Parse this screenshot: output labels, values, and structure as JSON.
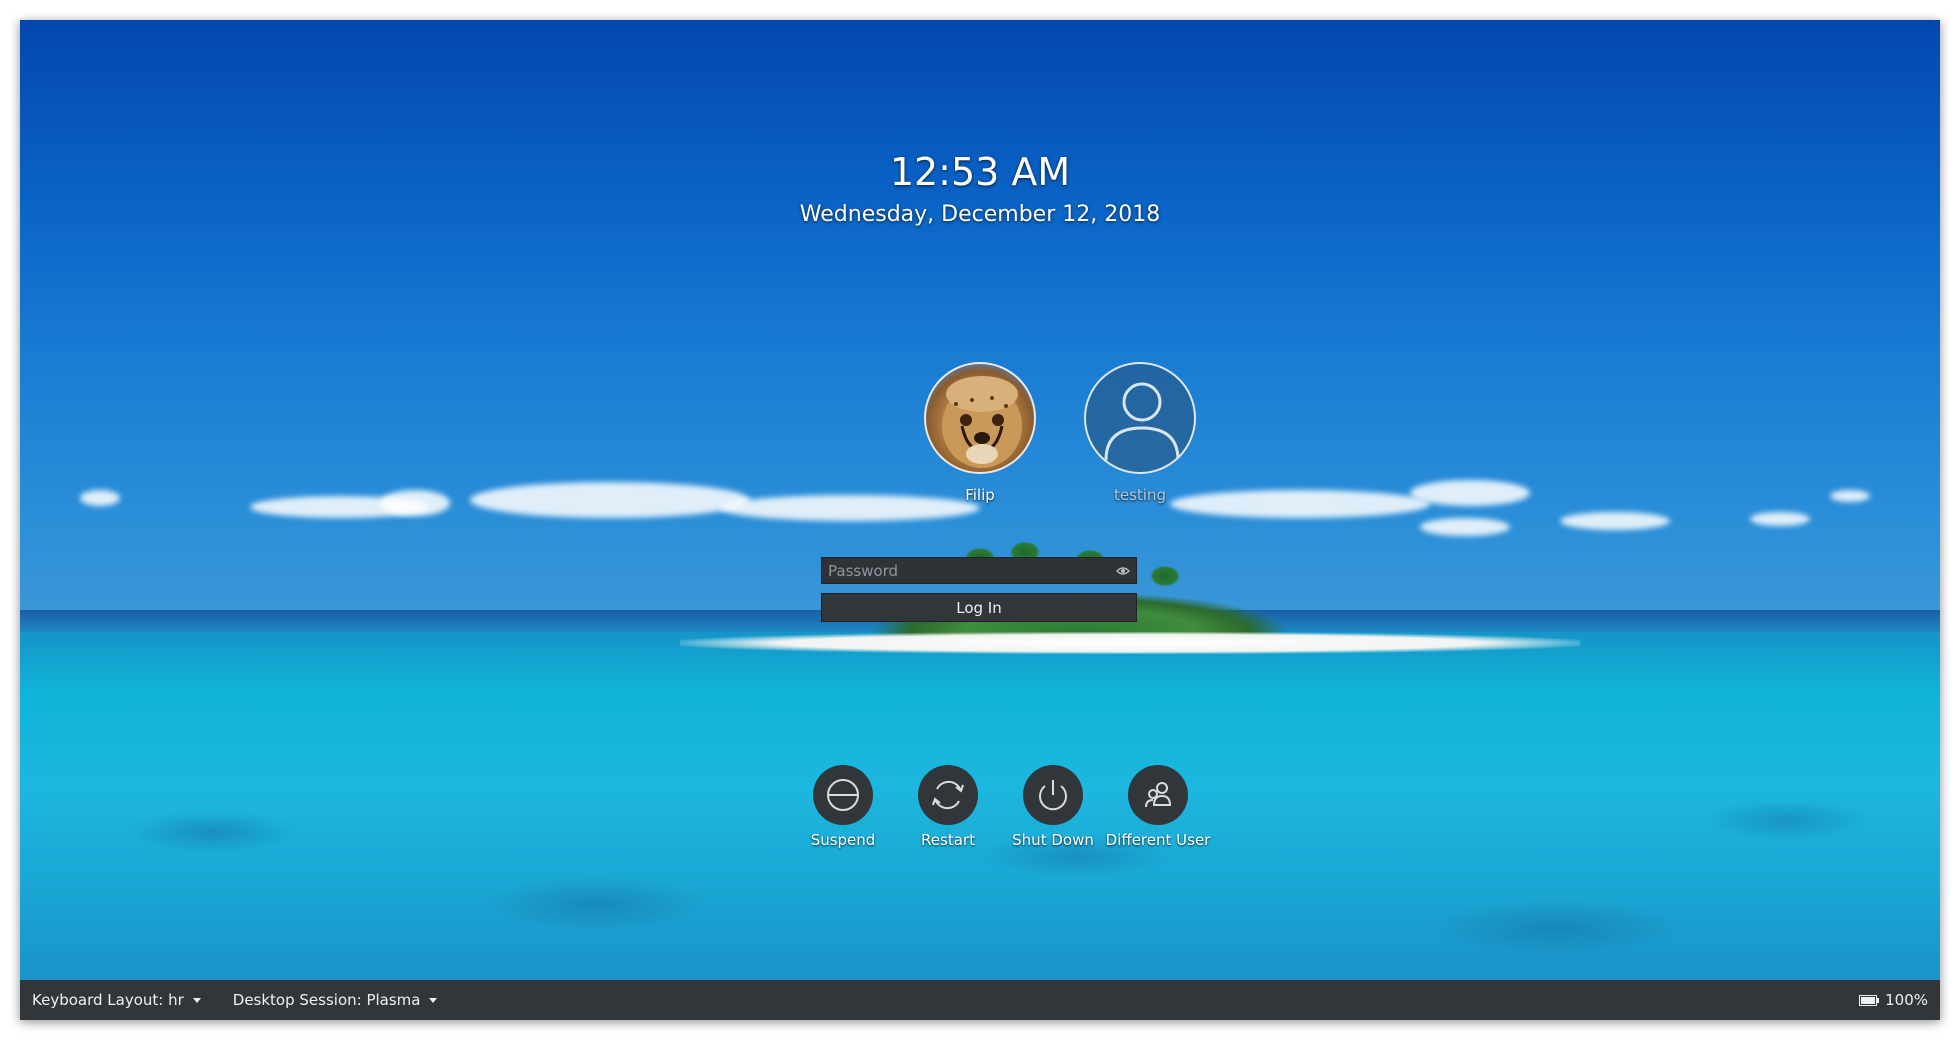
{
  "clock": {
    "time": "12:53 AM",
    "date": "Wednesday, December 12, 2018"
  },
  "users": [
    {
      "name": "Filip",
      "avatar": "cheetah-avatar"
    },
    {
      "name": "testing",
      "avatar": "generic-user-icon"
    }
  ],
  "login": {
    "password_placeholder": "Password",
    "password_value": "",
    "login_label": "Log In"
  },
  "actions": [
    {
      "label": "Suspend",
      "icon": "suspend-icon"
    },
    {
      "label": "Restart",
      "icon": "restart-icon"
    },
    {
      "label": "Shut Down",
      "icon": "shutdown-icon"
    },
    {
      "label": "Different User",
      "icon": "switch-user-icon"
    }
  ],
  "bottombar": {
    "keyboard_layout": "Keyboard Layout: hr",
    "desktop_session": "Desktop Session: Plasma",
    "battery_level": 1.0,
    "battery": "100%"
  }
}
